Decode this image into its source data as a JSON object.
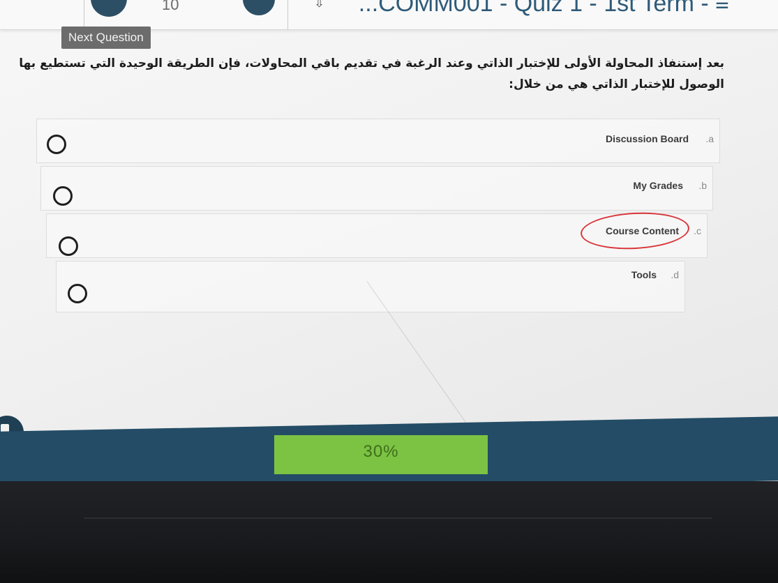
{
  "header": {
    "nav_number": "10",
    "quiz_title": "...COMM001 - Quiz 1 - 1st Term - ≡"
  },
  "next_question_label": "Next Question",
  "question": {
    "text": "بعد إستنفاذ المحاولة الأولى للإختبار الذاتي وعند الرغبة في تقديم باقي المحاولات، فإن الطريقة الوحيدة التي تستطيع بها الوصول للإختبار الذاتي هي من خلال:"
  },
  "options": [
    {
      "letter": ".a",
      "label": "Discussion Board"
    },
    {
      "letter": ".b",
      "label": "My Grades"
    },
    {
      "letter": ".c",
      "label": "Course Content",
      "circled": true
    },
    {
      "letter": ".d",
      "label": "Tools"
    }
  ],
  "progress": {
    "label": "30%",
    "value": 30
  },
  "colors": {
    "accent": "#244c66",
    "progress_fill": "#7cc243",
    "circle_mark": "#d8353a"
  }
}
